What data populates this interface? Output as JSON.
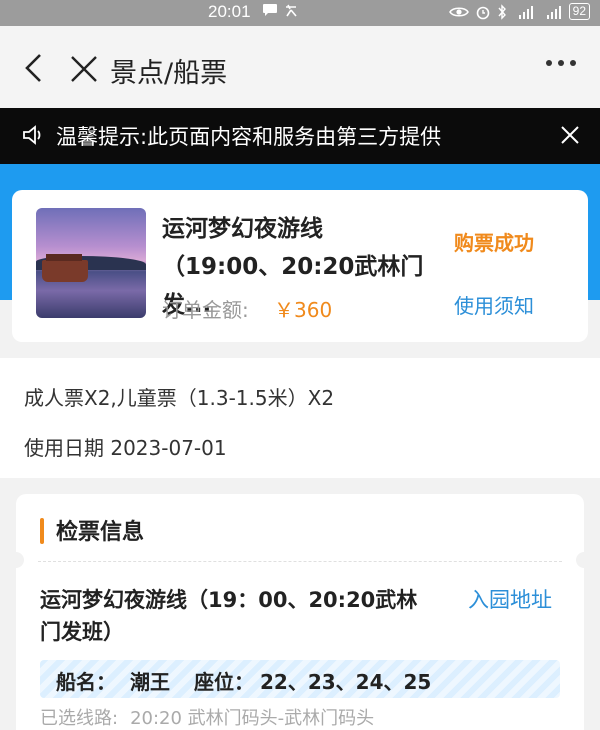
{
  "status_bar": {
    "time": "20:01",
    "battery": "92"
  },
  "nav": {
    "title": "景点/船票"
  },
  "notice": {
    "text": "温馨提示:此页面内容和服务由第三方提供"
  },
  "order": {
    "title": "运河梦幻夜游线（19:00、20:20武林门发...",
    "amount_label": "订单金额:",
    "amount_value": "￥360",
    "status": "购票成功",
    "usage_link": "使用须知"
  },
  "ticket": {
    "types": "成人票X2,儿童票（1.3-1.5米）X2",
    "date_label": "使用日期",
    "date_value": "2023-07-01"
  },
  "check": {
    "section_title": "检票信息",
    "route_name": "运河梦幻夜游线（19：00、20:20武林门发班）",
    "entry_link": "入园地址",
    "boat_label": "船名：",
    "boat_value": "潮王",
    "seat_label": "座位：",
    "seat_value": "22、23、24、25",
    "selected_label": "已选线路:",
    "selected_value": "20:20 武林门码头-武林门码头"
  }
}
